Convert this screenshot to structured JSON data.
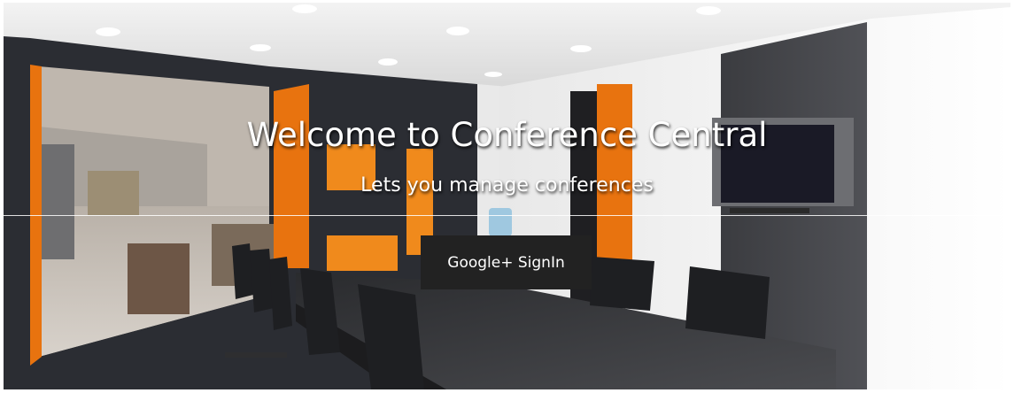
{
  "hero": {
    "title": "Welcome to Conference Central",
    "subtitle": "Lets you manage conferences",
    "signin_label": "Google+ SignIn",
    "background_image": "conference-room-photo"
  },
  "colors": {
    "button_bg": "#222222",
    "text": "#ffffff",
    "accent_orange": "#e8730f",
    "wall_dark": "#2b2d33"
  }
}
